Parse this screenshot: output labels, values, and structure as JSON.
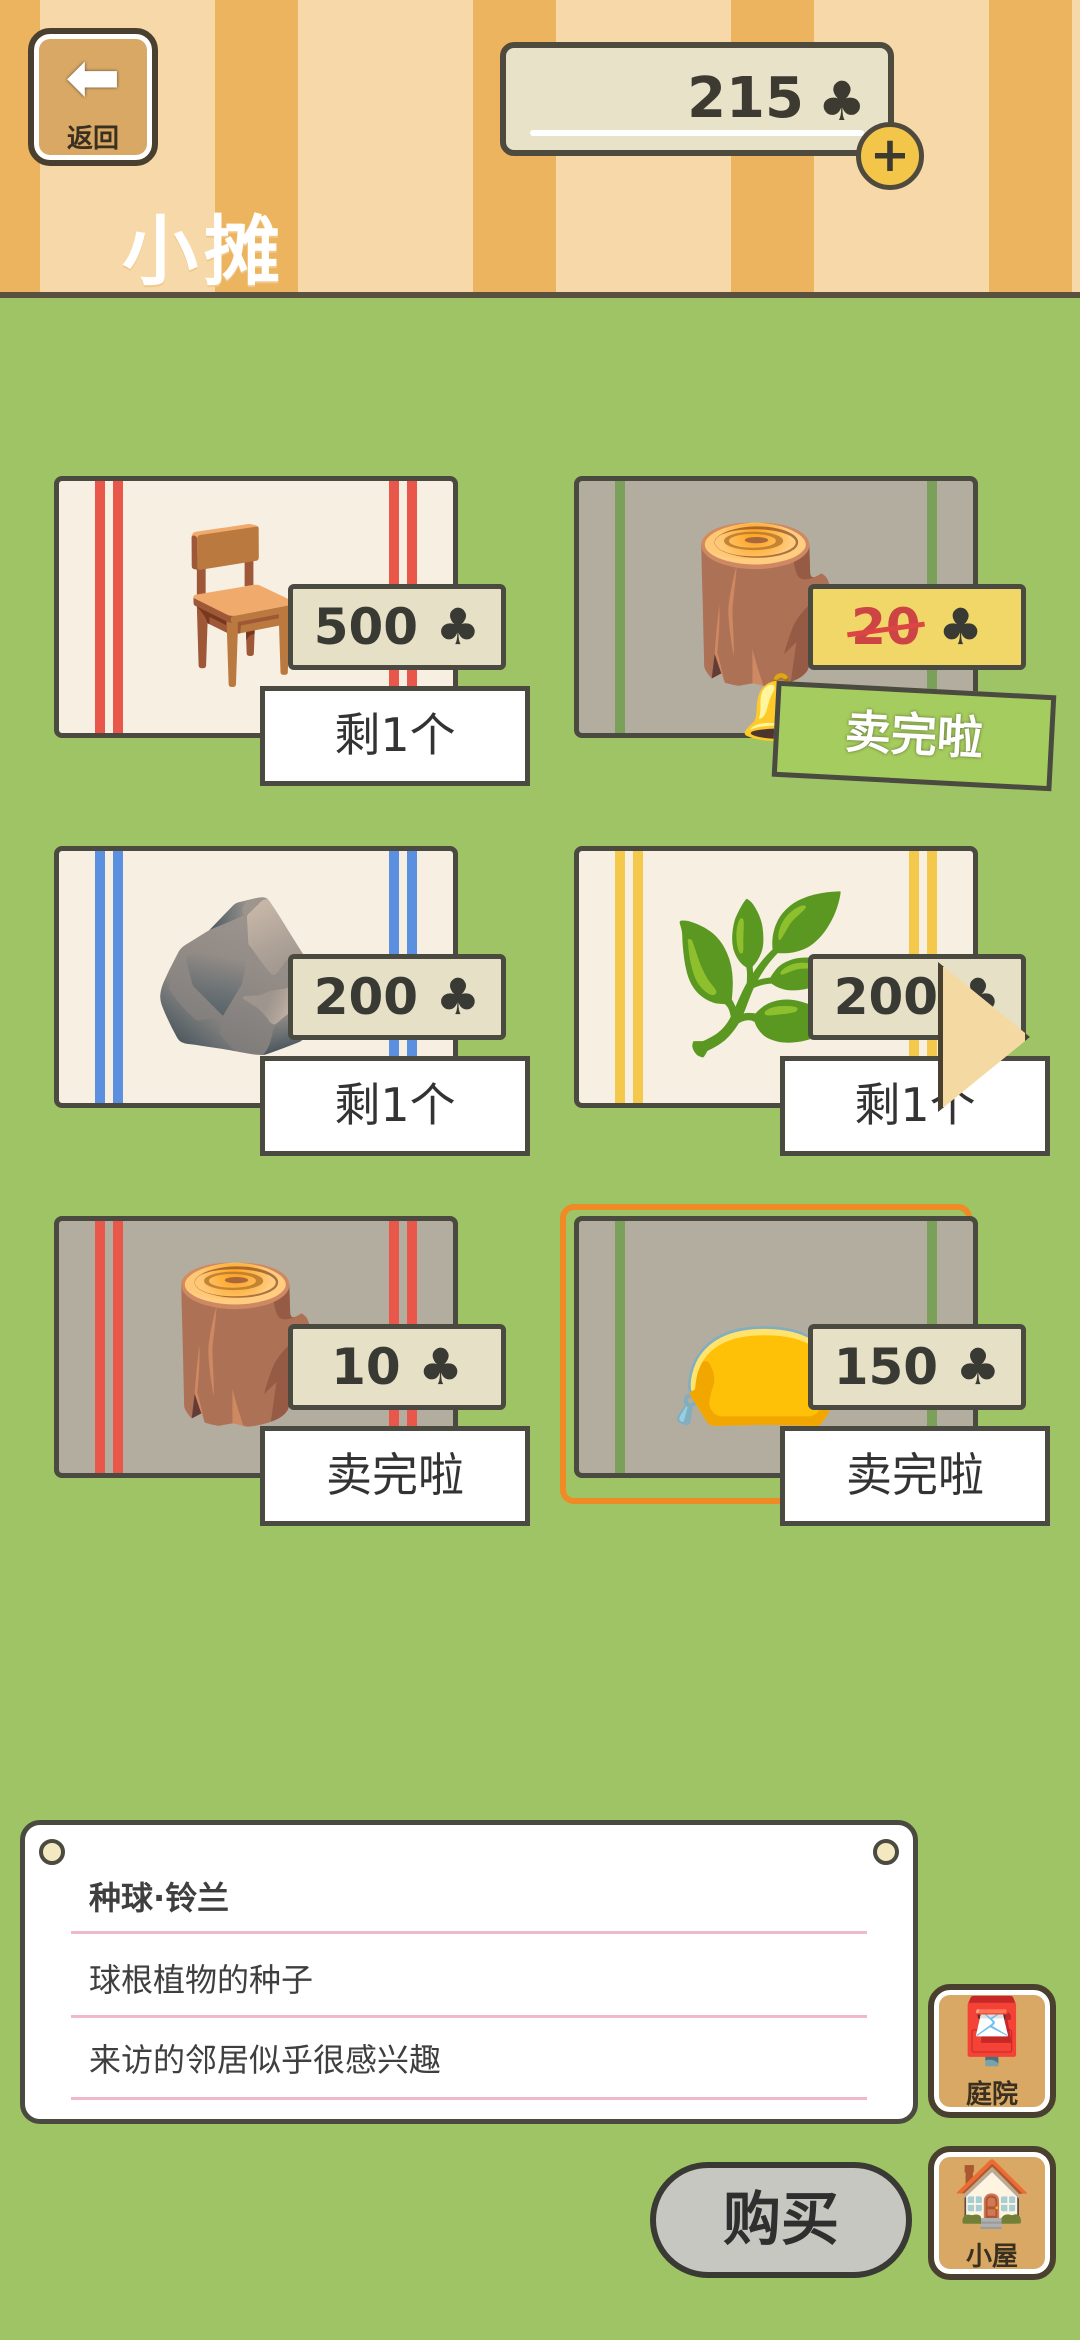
{
  "header": {
    "back_label": "返回",
    "title": "小摊",
    "clover_count": "215",
    "clover_icon": "clover-icon",
    "plus_icon": "plus-icon"
  },
  "items": [
    {
      "name": "table-card",
      "price": "500",
      "status": "剩1个",
      "status_type": "stock",
      "icon": "stool-card-icon",
      "mat": "light",
      "stripe": "#e8574a"
    },
    {
      "name": "mushroom",
      "price": "20",
      "status": "卖完啦",
      "status_type": "sold-green",
      "icon": "log-icon",
      "mat": "gray",
      "stripe": "#7ba05a",
      "sale": true
    },
    {
      "name": "stone",
      "price": "200",
      "status": "剩1个",
      "status_type": "stock",
      "icon": "stone-icon",
      "mat": "light",
      "stripe": "#5b8fe0"
    },
    {
      "name": "palm-leaf",
      "price": "200",
      "status": "剩1个",
      "status_type": "stock",
      "icon": "leaf-icon",
      "mat": "light",
      "stripe": "#f4c84a"
    },
    {
      "name": "driftwood",
      "price": "10",
      "status": "卖完啦",
      "status_type": "stock",
      "icon": "wood-icon",
      "mat": "gray",
      "stripe": "#e8574a"
    },
    {
      "name": "bulb-seed",
      "price": "150",
      "status": "卖完啦",
      "status_type": "stock",
      "icon": "seed-bag-icon",
      "mat": "gray",
      "stripe": "#7ba05a",
      "selected": true
    }
  ],
  "info": {
    "title": "种球·铃兰",
    "line1": "球根植物的种子",
    "line2": "来访的邻居似乎很感兴趣"
  },
  "side_buttons": {
    "yard_label": "庭院",
    "house_label": "小屋"
  },
  "buy_label": "购买"
}
